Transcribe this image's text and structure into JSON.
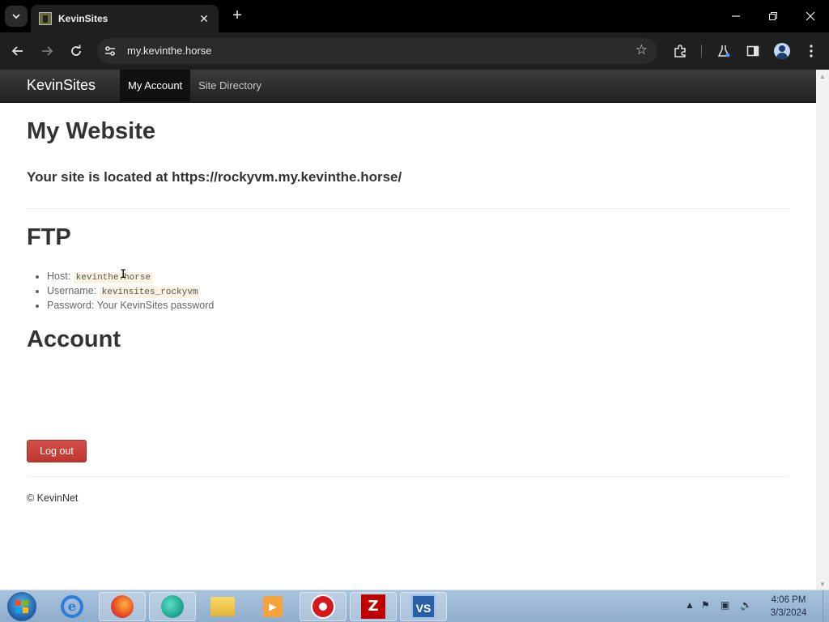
{
  "browser": {
    "tab_title": "KevinSites",
    "url": "my.kevinthe.horse"
  },
  "site": {
    "brand": "KevinSites",
    "nav": [
      {
        "label": "My Account",
        "active": true
      },
      {
        "label": "Site Directory",
        "active": false
      }
    ]
  },
  "main": {
    "heading": "My Website",
    "location_text": "Your site is located at https://rockyvm.my.kevinthe.horse/",
    "ftp": {
      "heading": "FTP",
      "host_label": "Host:",
      "host_value": "kevinthe.horse",
      "username_label": "Username:",
      "username_value": "kevinsites_rockyvm",
      "password_label": "Password:",
      "password_value": "Your KevinSites password"
    },
    "account": {
      "heading": "Account",
      "logout_label": "Log out"
    },
    "footer": "© KevinNet"
  },
  "taskbar": {
    "time": "4:06 PM",
    "date": "3/3/2024",
    "apps": [
      "internet-explorer",
      "firefox",
      "edge",
      "file-explorer",
      "media-player",
      "recorder",
      "filezilla",
      "visual-studio"
    ]
  },
  "colors": {
    "navbar": "#222222",
    "logout_button": "#d9534f",
    "code_background": "#fcf2e2",
    "browser_chrome": "#1f1f1f"
  }
}
